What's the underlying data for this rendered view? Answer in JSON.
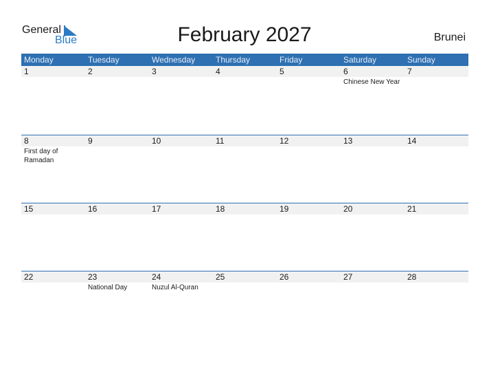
{
  "logo": {
    "general": "General",
    "blue": "Blue"
  },
  "title": "February 2027",
  "country": "Brunei",
  "colors": {
    "header_bg": "#2e70b2",
    "day_row_bg": "#f1f1f1",
    "logo_blue": "#2a7bc4"
  },
  "weekdays": [
    "Monday",
    "Tuesday",
    "Wednesday",
    "Thursday",
    "Friday",
    "Saturday",
    "Sunday"
  ],
  "weeks": [
    {
      "days": [
        "1",
        "2",
        "3",
        "4",
        "5",
        "6",
        "7"
      ],
      "events": [
        "",
        "",
        "",
        "",
        "",
        "Chinese New Year",
        ""
      ]
    },
    {
      "days": [
        "8",
        "9",
        "10",
        "11",
        "12",
        "13",
        "14"
      ],
      "events": [
        "First day of Ramadan",
        "",
        "",
        "",
        "",
        "",
        ""
      ]
    },
    {
      "days": [
        "15",
        "16",
        "17",
        "18",
        "19",
        "20",
        "21"
      ],
      "events": [
        "",
        "",
        "",
        "",
        "",
        "",
        ""
      ]
    },
    {
      "days": [
        "22",
        "23",
        "24",
        "25",
        "26",
        "27",
        "28"
      ],
      "events": [
        "",
        "National Day",
        "Nuzul Al-Quran",
        "",
        "",
        "",
        ""
      ]
    }
  ]
}
